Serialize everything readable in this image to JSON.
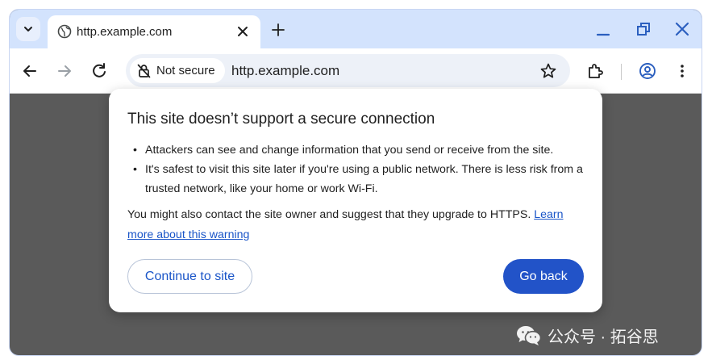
{
  "tab": {
    "title": "http.example.com",
    "favicon": "globe-icon",
    "close": "close-icon"
  },
  "toolbar": {
    "security_label": "Not secure",
    "url": "http.example.com",
    "icons": [
      "back-icon",
      "forward-icon",
      "reload-icon",
      "not-secure-icon",
      "star-icon",
      "extensions-icon",
      "profile-icon",
      "more-icon"
    ]
  },
  "window_controls": [
    "minimize-icon",
    "restore-icon",
    "close-window-icon"
  ],
  "dialog": {
    "title": "This site doesn’t support a secure connection",
    "bullets": [
      "Attackers can see and change information that you send or receive from the site.",
      "It's safest to visit this site later if you're using a public network. There is less risk from a trusted network, like your home or work Wi-Fi."
    ],
    "note": "You might also contact the site owner and suggest that they upgrade to HTTPS.",
    "learn_more": "Learn more about this warning",
    "continue_label": "Continue to site",
    "back_label": "Go back"
  },
  "watermark": {
    "text": "公众号 · 拓谷思",
    "icon": "wechat-icon"
  },
  "colors": {
    "tabstrip": "#d3e3fd",
    "omnibox": "#edf1f8",
    "accent": "#2253c8",
    "link": "#1a55c8",
    "backdrop": "#5a5a5a"
  }
}
